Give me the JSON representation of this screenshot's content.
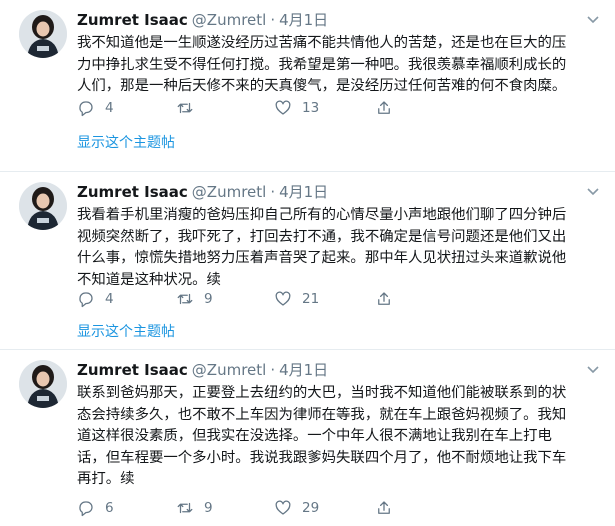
{
  "tweets": [
    {
      "name": "Zumret Isaac",
      "handle": "@Zumretl",
      "dot": "·",
      "date": "4月1日",
      "text": "我不知道他是一生顺遂没经历过苦痛不能共情他人的苦楚，还是也在巨大的压\n力中挣扎求生受不得任何打搅。我希望是第一种吧。我很羡慕幸福顺利成长的\n人们，那是一种后天修不来的天真傻气，是没经历过任何苦难的何不食肉糜。",
      "replies": "4",
      "retweets": "",
      "likes": "13",
      "thread_link": "显示这个主题帖"
    },
    {
      "name": "Zumret Isaac",
      "handle": "@Zumretl",
      "dot": "·",
      "date": "4月1日",
      "text": "我看着手机里消瘦的爸妈压抑自己所有的心情尽量小声地跟他们聊了四分钟后\n视频突然断了，我吓死了，打回去打不通，我不确定是信号问题还是他们又出\n什么事，惊慌失措地努力压着声音哭了起来。那中年人见状扭过头来道歉说他\n不知道是这种状况。续",
      "replies": "4",
      "retweets": "9",
      "likes": "21",
      "thread_link": "显示这个主题帖"
    },
    {
      "name": "Zumret Isaac",
      "handle": "@Zumretl",
      "dot": "·",
      "date": "4月1日",
      "text": "联系到爸妈那天，正要登上去纽约的大巴，当时我不知道他们能被联系到的状\n态会持续多久，也不敢不上车因为律师在等我，就在车上跟爸妈视频了。我知\n道这样很没素质，但我实在没选择。一个中年人很不满地让我别在车上打电\n话，但车程要一个多小时。我说我跟爹妈失联四个月了，他不耐烦地让我下车\n再打。续",
      "replies": "6",
      "retweets": "9",
      "likes": "29",
      "thread_link": ""
    }
  ],
  "icons": {
    "reply": "reply-icon",
    "retweet": "retweet-icon",
    "like": "heart-icon",
    "share": "share-icon",
    "caret": "chevron-down-icon"
  },
  "colors": {
    "link": "#1b95e0",
    "secondary": "#657786",
    "text": "#14171a",
    "divider": "#e6ecf0"
  }
}
